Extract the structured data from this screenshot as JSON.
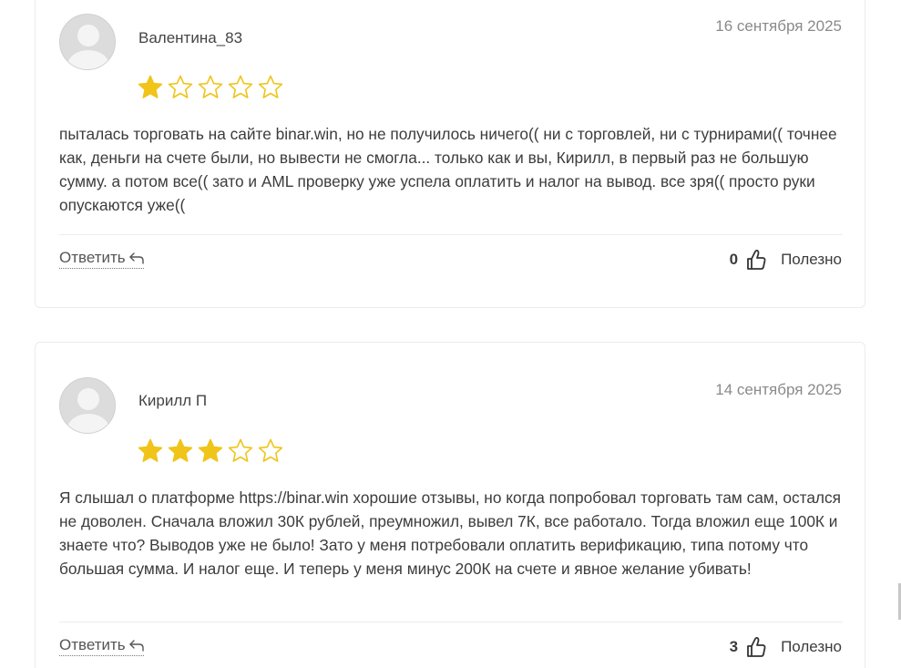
{
  "reviews": [
    {
      "author": "Валентина_83",
      "date": "16 сентября 2025",
      "rating": 1,
      "max_rating": 5,
      "text": "пыталась торговать на сайте binar.win, но не получилось ничего(( ни с торговлей, ни с турнирами(( точнее как, деньги на счете были, но вывести не смогла... только как и вы, Кирилл, в первый раз не большую сумму. а потом все(( зато и AML проверку уже успела оплатить и налог на вывод. все зря(( просто руки опускаются уже((",
      "reply_label": "Ответить",
      "votes": "0",
      "helpful_label": "Полезно"
    },
    {
      "author": "Кирилл П",
      "date": "14 сентября 2025",
      "rating": 3,
      "max_rating": 5,
      "text": "Я слышал о платформе https://binar.win хорошие отзывы, но когда попробовал торговать там сам, остался не доволен. Сначала вложил 30К рублей, преумножил, вывел 7К, все работало. Тогда вложил еще 100К и знаете что? Выводов уже не было! Зато у меня потребовали оплатить верификацию, типа потому что большая сумма. И налог еще. И теперь у меня минус 200К на счете и явное желание убивать!",
      "reply_label": "Ответить",
      "votes": "3",
      "helpful_label": "Полезно"
    }
  ],
  "colors": {
    "star_filled": "#f0c419",
    "star_empty_stroke": "#f0c419",
    "card_border": "#ececec",
    "date_text": "#8a8a8a"
  },
  "icons": {
    "reply": "reply-arrow-icon",
    "helpful": "thumbs-up-icon",
    "avatar": "user-avatar-icon",
    "star": "star-icon"
  }
}
